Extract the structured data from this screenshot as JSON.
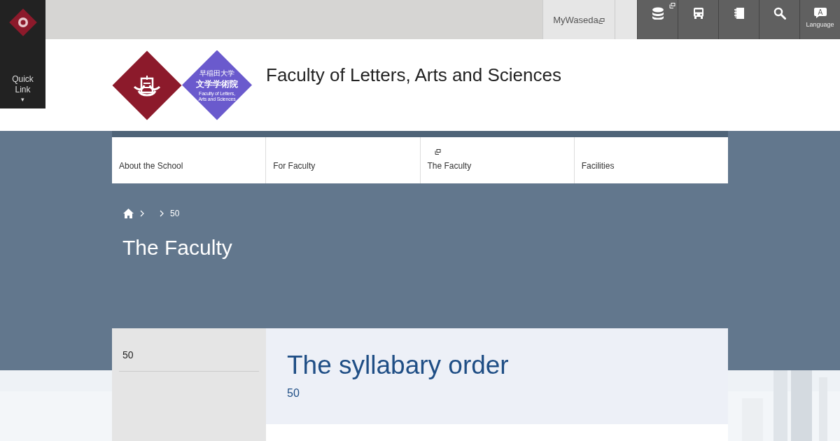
{
  "quick_link": {
    "label": "Quick Link",
    "caret": "▾"
  },
  "top_bar": {
    "mywaseda": "MyWaseda",
    "tools": [
      {
        "kind": "database",
        "external": true
      },
      {
        "kind": "bus",
        "external": false
      },
      {
        "kind": "notebook",
        "external": false
      },
      {
        "kind": "search",
        "external": false
      },
      {
        "kind": "language",
        "letter": "A",
        "label": "Language",
        "external": false
      }
    ]
  },
  "logo": {
    "university": "早稲田大学",
    "school": "文学学術院",
    "english": [
      "Faculty of Letters,",
      "Arts and Sciences"
    ]
  },
  "site_title": "Faculty of Letters, Arts and Sciences",
  "nav": [
    {
      "label": "About the School",
      "external": false
    },
    {
      "label": "For Faculty",
      "external": false
    },
    {
      "label": "The Faculty",
      "external": true
    },
    {
      "label": "Facilities",
      "external": false
    }
  ],
  "breadcrumb": [
    {
      "kind": "blank"
    },
    {
      "kind": "link",
      "label": "50"
    }
  ],
  "page_title": "The Faculty",
  "side_menu": [
    {
      "label": "50",
      "selected": true
    }
  ],
  "content": {
    "heading": "The syllabary order",
    "subheading": "50"
  }
}
